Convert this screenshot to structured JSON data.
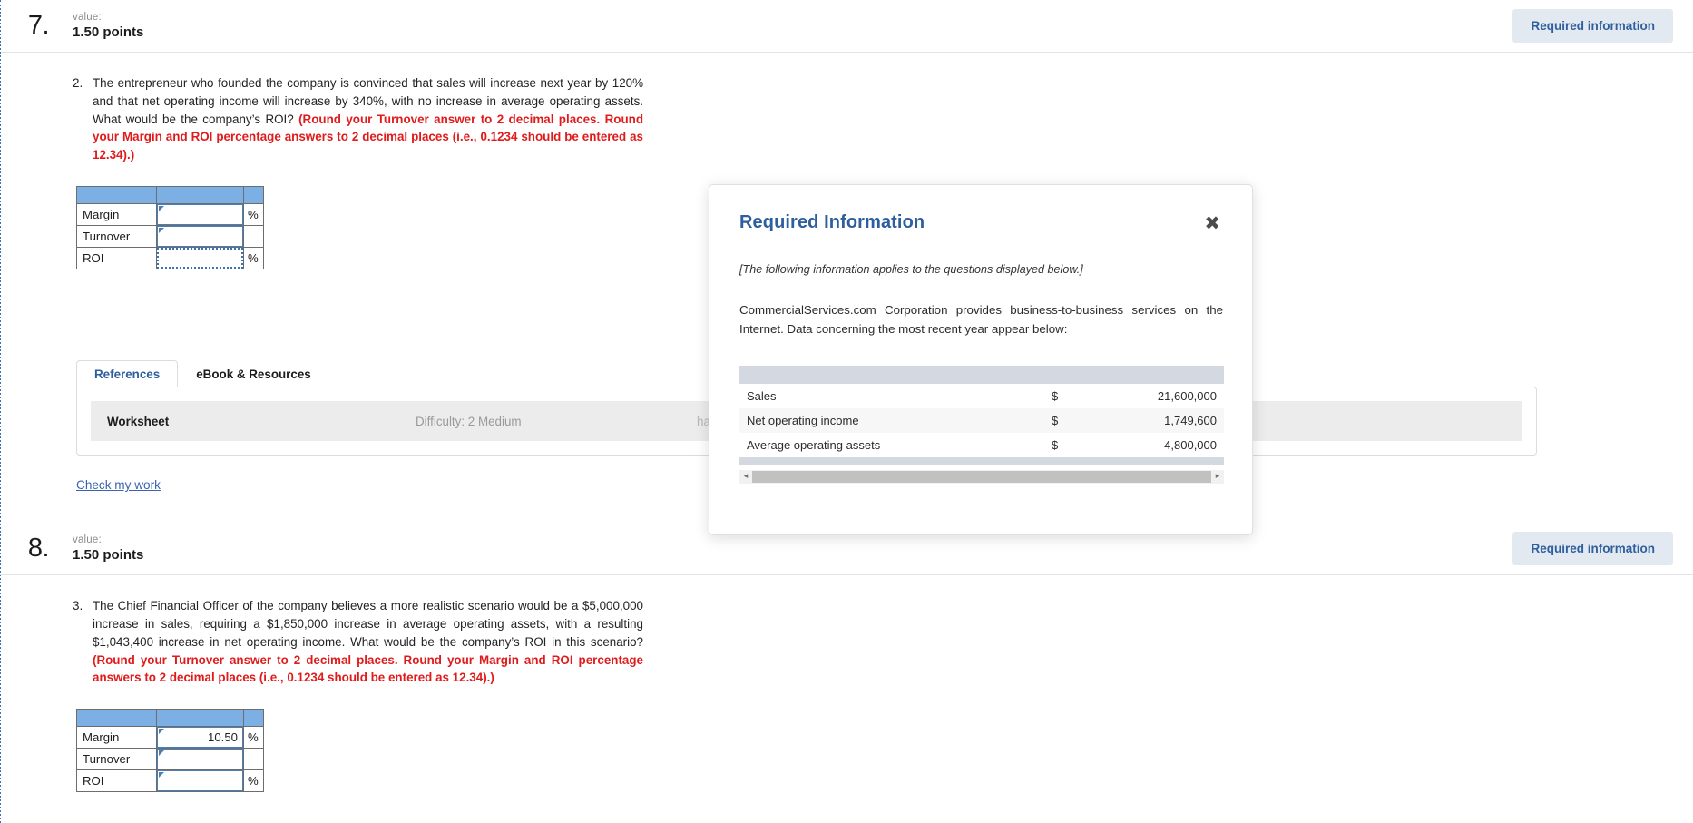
{
  "questions": [
    {
      "number": "7.",
      "value_label": "value:",
      "points": "1.50 points",
      "required_button": "Required information",
      "item_marker": "2.",
      "text_black_1": "The entrepreneur who founded the company is convinced that sales will increase next year by 120% and that net operating income will increase by 340%, with no increase in average operating assets. What would be the company’s ROI? ",
      "text_red_1": "(Round your Turnover answer to 2 decimal places. Round your Margin and ROI percentage answers to 2 decimal places (i.e., 0.1234 should be entered as 12.34).)",
      "table": {
        "rows": [
          {
            "label": "Margin",
            "value": "",
            "suffix": "%"
          },
          {
            "label": "Turnover",
            "value": "",
            "suffix": ""
          },
          {
            "label": "ROI",
            "value": "",
            "suffix": "%"
          }
        ]
      }
    },
    {
      "number": "8.",
      "value_label": "value:",
      "points": "1.50 points",
      "required_button": "Required information",
      "item_marker": "3.",
      "text_black_1": "The Chief Financial Officer of the company believes a more realistic scenario would be a $5,000,000 increase in sales, requiring a $1,850,000 increase in average operating assets, with a resulting $1,043,400 increase in net operating income. What would be the company’s ROI in this scenario? ",
      "text_red_1": "(Round your Turnover answer to 2 decimal places. Round your Margin and ROI percentage answers to 2 decimal places (i.e., 0.1234 should be entered as 12.34).)",
      "table": {
        "rows": [
          {
            "label": "Margin",
            "value": "10.50",
            "suffix": "%"
          },
          {
            "label": "Turnover",
            "value": "",
            "suffix": ""
          },
          {
            "label": "ROI",
            "value": "",
            "suffix": "%"
          }
        ]
      }
    }
  ],
  "tabs": {
    "references": "References",
    "ebook": "eBook & Resources"
  },
  "worksheet": {
    "title": "Worksheet",
    "difficulty": "Difficulty: 2 Medium",
    "learning_objective": "hanges in sales, expenses, and assets affect"
  },
  "check_my_work": "Check my work",
  "modal": {
    "title": "Required Information",
    "close_icon": "close-icon",
    "italic_note": "[The following information applies to the questions displayed below.]",
    "paragraph": "CommercialServices.com Corporation provides business-to-business services on the Internet. Data concerning the most recent year appear below:",
    "table_rows": [
      {
        "label": "Sales",
        "currency": "$",
        "value": "21,600,000"
      },
      {
        "label": "Net operating income",
        "currency": "$",
        "value": "1,749,600"
      },
      {
        "label": "Average operating assets",
        "currency": "$",
        "value": "4,800,000"
      }
    ],
    "scrollbar": {
      "left_arrow": "◂",
      "right_arrow": "▸"
    }
  },
  "colors": {
    "table_header_blue": "#7cafe3",
    "accent_blue": "#2d5f9e",
    "red_text": "#e01b1b",
    "modal_header_gray": "#d4d9e1"
  }
}
